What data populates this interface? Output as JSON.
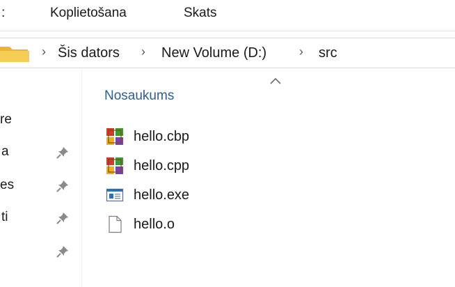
{
  "ribbon": {
    "tabs": [
      {
        "label": ":"
      },
      {
        "label": "Koplietošana"
      },
      {
        "label": "Skats"
      }
    ]
  },
  "address": {
    "crumbs": [
      {
        "label": "Šis dators"
      },
      {
        "label": "New Volume (D:)"
      },
      {
        "label": "src"
      }
    ],
    "separator_glyph": "›"
  },
  "navpane": {
    "items": [
      {
        "label": "re",
        "pinned": false
      },
      {
        "label": "a",
        "pinned": true
      },
      {
        "label": "es",
        "pinned": true
      },
      {
        "label": "ti",
        "pinned": true
      },
      {
        "label": "",
        "pinned": true
      }
    ]
  },
  "filelist": {
    "column_header": "Nosaukums",
    "sort": "ascending",
    "files": [
      {
        "name": "hello.cbp",
        "icon": "codeblocks-project-icon"
      },
      {
        "name": "hello.cpp",
        "icon": "codeblocks-source-icon"
      },
      {
        "name": "hello.exe",
        "icon": "executable-icon"
      },
      {
        "name": "hello.o",
        "icon": "blank-file-icon"
      }
    ]
  },
  "colors": {
    "folder": "#f2c94c",
    "header_text": "#2f5d8a",
    "pin": "#8a8a8a"
  }
}
